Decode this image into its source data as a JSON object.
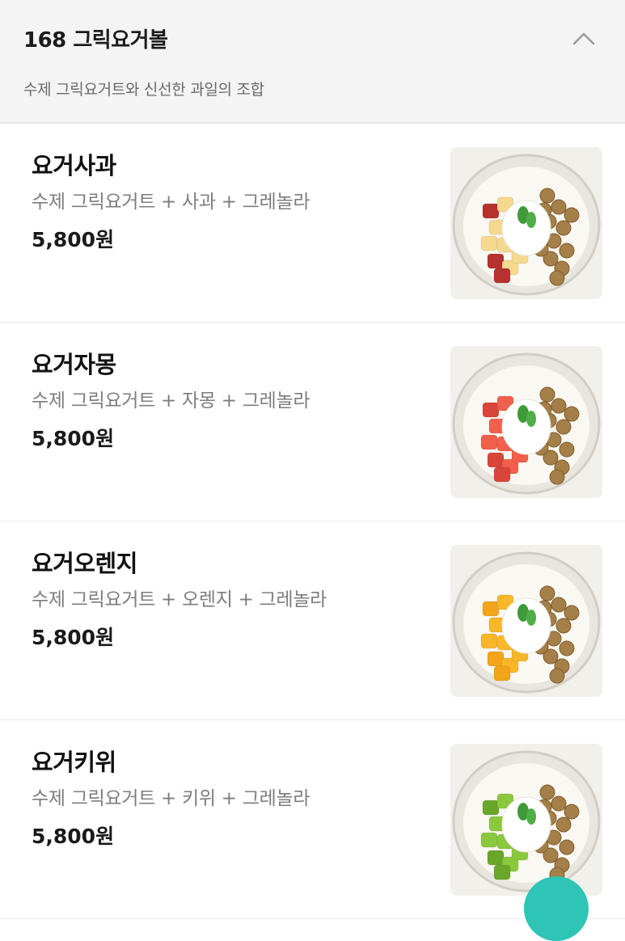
{
  "section": {
    "title": "168 그릭요거볼",
    "description": "수제 그릭요거트와 신선한 과일의 조합",
    "toggle_icon": "chevron-up-icon"
  },
  "items": [
    {
      "name": "요거사과",
      "description": "수제 그릭요거트 + 사과 + 그레놀라",
      "price": "5,800원",
      "fruit_color": "#f5d98e",
      "fruit_accent": "#b5322f"
    },
    {
      "name": "요거자몽",
      "description": "수제 그릭요거트 + 자몽 + 그레놀라",
      "price": "5,800원",
      "fruit_color": "#f0604c",
      "fruit_accent": "#d9453a"
    },
    {
      "name": "요거오렌지",
      "description": "수제 그릭요거트 + 오렌지 + 그레놀라",
      "price": "5,800원",
      "fruit_color": "#f7b728",
      "fruit_accent": "#f2a41a"
    },
    {
      "name": "요거키위",
      "description": "수제 그릭요거트 + 키위 + 그레놀라",
      "price": "5,800원",
      "fruit_color": "#8cc83d",
      "fruit_accent": "#6aa62a"
    }
  ],
  "colors": {
    "header_bg": "#f4f4f4",
    "granola": "#a57f48",
    "yogurt": "#ffffff",
    "fab": "#2ec4b6"
  }
}
